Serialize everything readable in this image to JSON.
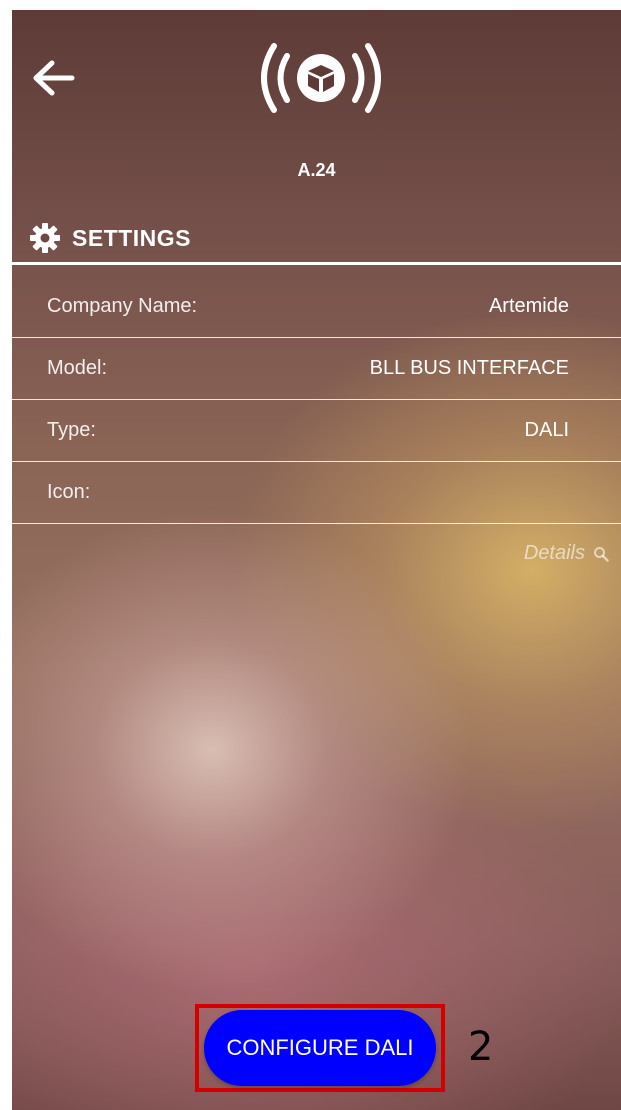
{
  "header": {
    "back_icon": "arrow-left-icon",
    "device_icon": "wireless-cube-icon",
    "device_id": "A.24"
  },
  "settings": {
    "icon": "gear-icon",
    "title": "SETTINGS",
    "rows": [
      {
        "label": "Company Name:",
        "value": "Artemide"
      },
      {
        "label": "Model:",
        "value": "BLL BUS INTERFACE"
      },
      {
        "label": "Type:",
        "value": "DALI"
      },
      {
        "label": "Icon:",
        "value": ""
      }
    ]
  },
  "details": {
    "label": "Details",
    "icon": "search-icon"
  },
  "action": {
    "configure_label": "CONFIGURE DALI",
    "color": "#0000ff",
    "highlight_color": "#d40000",
    "step_number": "2"
  }
}
